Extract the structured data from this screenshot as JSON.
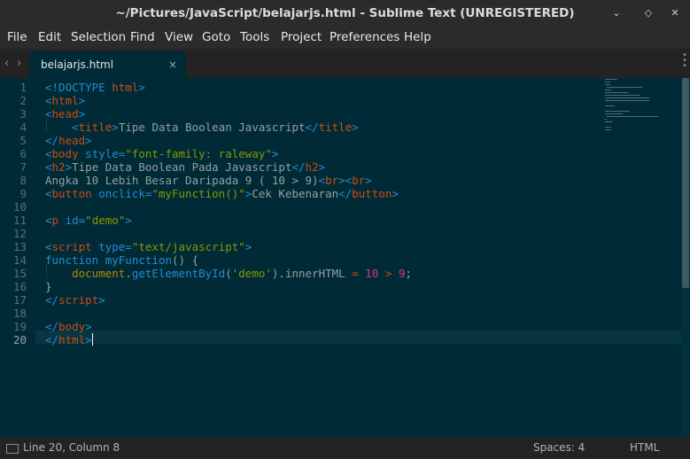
{
  "window": {
    "title": "~/Pictures/JavaScript/belajarjs.html - Sublime Text (UNREGISTERED)",
    "minimize_glyph": "⌄",
    "restore_glyph": "◇",
    "close_glyph": "✕"
  },
  "menu": [
    "File",
    "Edit",
    "Selection",
    "Find",
    "View",
    "Goto",
    "Tools",
    "Project",
    "Preferences",
    "Help"
  ],
  "tabs": [
    {
      "label": "belajarjs.html",
      "close_glyph": "×",
      "active": true
    }
  ],
  "nav": {
    "back_glyph": "‹",
    "forward_glyph": "›"
  },
  "editor": {
    "line_numbers": [
      "1",
      "2",
      "3",
      "4",
      "5",
      "6",
      "7",
      "8",
      "9",
      "10",
      "11",
      "12",
      "13",
      "14",
      "15",
      "16",
      "17",
      "18",
      "19",
      "20"
    ],
    "current_line": 20,
    "lines": [
      [
        [
          "<!DOCTYPE ",
          "t-tag"
        ],
        [
          "html",
          "t-name"
        ],
        [
          ">",
          "t-tag"
        ]
      ],
      [
        [
          "<",
          "t-tag"
        ],
        [
          "html",
          "t-name"
        ],
        [
          ">",
          "t-tag"
        ]
      ],
      [
        [
          "<",
          "t-tag"
        ],
        [
          "head",
          "t-name"
        ],
        [
          ">",
          "t-tag"
        ]
      ],
      [
        [
          "    ",
          "t-plain"
        ],
        [
          "<",
          "t-tag"
        ],
        [
          "title",
          "t-name"
        ],
        [
          ">",
          "t-tag"
        ],
        [
          "Tipe Data Boolean Javascript",
          "t-text"
        ],
        [
          "</",
          "t-tag"
        ],
        [
          "title",
          "t-name"
        ],
        [
          ">",
          "t-tag"
        ]
      ],
      [
        [
          "</",
          "t-tag"
        ],
        [
          "head",
          "t-name"
        ],
        [
          ">",
          "t-tag"
        ]
      ],
      [
        [
          "<",
          "t-tag"
        ],
        [
          "body",
          "t-name"
        ],
        [
          " style=",
          "t-attr"
        ],
        [
          "\"font-family: raleway\"",
          "t-str"
        ],
        [
          ">",
          "t-tag"
        ]
      ],
      [
        [
          "<",
          "t-tag"
        ],
        [
          "h2",
          "t-name"
        ],
        [
          ">",
          "t-tag"
        ],
        [
          "Tipe Data Boolean Pada Javascript",
          "t-text"
        ],
        [
          "</",
          "t-tag"
        ],
        [
          "h2",
          "t-name"
        ],
        [
          ">",
          "t-tag"
        ]
      ],
      [
        [
          "Angka 10 Lebih Besar Daripada 9 ( 10 > 9)",
          "t-text"
        ],
        [
          "<",
          "t-tag"
        ],
        [
          "br",
          "t-name"
        ],
        [
          "><",
          "t-tag"
        ],
        [
          "br",
          "t-name"
        ],
        [
          ">",
          "t-tag"
        ]
      ],
      [
        [
          "<",
          "t-tag"
        ],
        [
          "button",
          "t-name"
        ],
        [
          " onclick=",
          "t-attr"
        ],
        [
          "\"myFunction()\"",
          "t-str"
        ],
        [
          ">",
          "t-tag"
        ],
        [
          "Cek Kebenaran",
          "t-text"
        ],
        [
          "</",
          "t-tag"
        ],
        [
          "button",
          "t-name"
        ],
        [
          ">",
          "t-tag"
        ]
      ],
      [],
      [
        [
          "<",
          "t-tag"
        ],
        [
          "p",
          "t-name"
        ],
        [
          " id=",
          "t-attr"
        ],
        [
          "\"demo\"",
          "t-str"
        ],
        [
          ">",
          "t-tag"
        ]
      ],
      [],
      [
        [
          "<",
          "t-tag"
        ],
        [
          "script",
          "t-name"
        ],
        [
          " type=",
          "t-attr"
        ],
        [
          "\"text/javascript\"",
          "t-str"
        ],
        [
          ">",
          "t-tag"
        ]
      ],
      [
        [
          "function ",
          "t-kw"
        ],
        [
          "myFunction",
          "t-fn"
        ],
        [
          "() {",
          "t-plain"
        ]
      ],
      [
        [
          "    ",
          "t-plain"
        ],
        [
          "document",
          "t-id"
        ],
        [
          ".",
          "t-plain"
        ],
        [
          "getElementById",
          "t-fn"
        ],
        [
          "(",
          "t-plain"
        ],
        [
          "'demo'",
          "t-str"
        ],
        [
          ").innerHTML ",
          "t-plain"
        ],
        [
          "=",
          "t-op"
        ],
        [
          " ",
          "t-plain"
        ],
        [
          "10",
          "t-num"
        ],
        [
          " ",
          "t-plain"
        ],
        [
          ">",
          "t-op"
        ],
        [
          " ",
          "t-plain"
        ],
        [
          "9",
          "t-num"
        ],
        [
          ";",
          "t-plain"
        ]
      ],
      [
        [
          "}",
          "t-plain"
        ]
      ],
      [
        [
          "</",
          "t-tag"
        ],
        [
          "script",
          "t-name"
        ],
        [
          ">",
          "t-tag"
        ]
      ],
      [],
      [
        [
          "</",
          "t-tag"
        ],
        [
          "body",
          "t-name"
        ],
        [
          ">",
          "t-tag"
        ]
      ],
      [
        [
          "</",
          "t-tag"
        ],
        [
          "html",
          "t-name"
        ],
        [
          ">",
          "t-tag"
        ]
      ]
    ]
  },
  "status": {
    "position": "Line 20, Column 8",
    "indent": "Spaces: 4",
    "syntax": "HTML"
  },
  "colors": {
    "background": "#002b36",
    "tag": "#268bd2",
    "tag_name": "#cb4b16",
    "string": "#859900",
    "number": "#d33682",
    "text": "#93a1a1"
  }
}
